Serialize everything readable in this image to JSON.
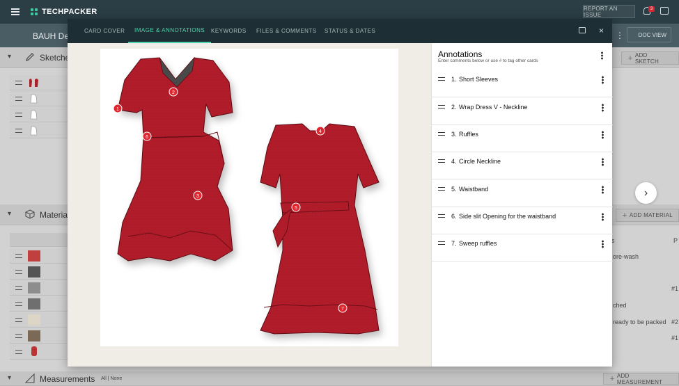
{
  "app": {
    "brand": "TECHPACKER",
    "report_issue": "REPORT AN ISSUE",
    "notification_count": "3",
    "doc_title": "BAUH Des",
    "doc_view_label": "DOC VIEW"
  },
  "sections": {
    "sketches": {
      "label": "Sketche",
      "button": "ADD SKETCH"
    },
    "materials": {
      "label": "Materia",
      "button": "ADD MATERIAL"
    },
    "measurements": {
      "label": "Measurements",
      "filter": "All | None",
      "button": "ADD MEASUREMENT"
    }
  },
  "materials_cells": {
    "col_head": "s",
    "col_head2": "P",
    "c1": "ore-wash",
    "c2": "#1",
    "c3": "ched",
    "c4": "ready to be packed",
    "c5": "#2",
    "c6": "#1"
  },
  "modal": {
    "tabs": [
      "CARD COVER",
      "IMAGE & ANNOTATIONS",
      "KEYWORDS",
      "FILES & COMMENTS",
      "STATUS & DATES"
    ],
    "active_tab": "IMAGE & ANNOTATIONS",
    "close": "×"
  },
  "annotations": {
    "title": "Annotations",
    "subtitle": "Enter comments below or use # to tag other cards",
    "items": [
      {
        "num": "1.",
        "text": "Short Sleeves"
      },
      {
        "num": "2.",
        "text": "Wrap Dress V - Neckline"
      },
      {
        "num": "3.",
        "text": "Ruffles"
      },
      {
        "num": "4.",
        "text": "Circle Neckline"
      },
      {
        "num": "5.",
        "text": "Waistband"
      },
      {
        "num": "6.",
        "text": "Side slit  Opening for the waistband"
      },
      {
        "num": "7.",
        "text": "Sweep ruffles"
      }
    ]
  },
  "markers": [
    "1",
    "2",
    "3",
    "4",
    "5",
    "6",
    "7"
  ],
  "colors": {
    "dress_red": "#b01e2a",
    "marker_red": "#e0262f",
    "accent_teal": "#4fd4b0",
    "header_dark": "#1d2f34"
  }
}
